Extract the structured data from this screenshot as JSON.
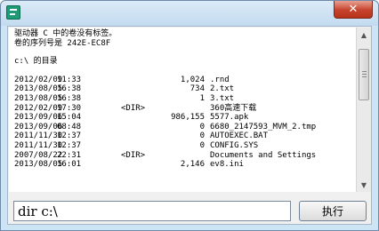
{
  "window": {
    "icon": "app-icon",
    "close_symbol": "✕"
  },
  "output": {
    "header_lines": [
      "驱动器 C 中的卷没有标签。",
      "卷的序列号是 242E-EC8F"
    ],
    "dir_title": "c:\\ 的目录",
    "entries": [
      {
        "date": "2012/02/09",
        "time": "11:33",
        "dir": "",
        "size": "1,024",
        "name": ".rnd"
      },
      {
        "date": "2013/08/05",
        "time": "16:38",
        "dir": "",
        "size": "734",
        "name": "2.txt"
      },
      {
        "date": "2013/08/05",
        "time": "16:38",
        "dir": "",
        "size": "1",
        "name": "3.txt"
      },
      {
        "date": "2012/02/09",
        "time": "17:30",
        "dir": "<DIR>",
        "size": "",
        "name": "360高速下载"
      },
      {
        "date": "2013/09/06",
        "time": "15:04",
        "dir": "",
        "size": "986,155",
        "name": "5577.apk"
      },
      {
        "date": "2013/09/06",
        "time": "08:48",
        "dir": "",
        "size": "0",
        "name": "6680_2147593_MVM_2.tmp"
      },
      {
        "date": "2011/11/30",
        "time": "12:37",
        "dir": "",
        "size": "0",
        "name": "AUTOEXEC.BAT"
      },
      {
        "date": "2011/11/30",
        "time": "12:37",
        "dir": "",
        "size": "0",
        "name": "CONFIG.SYS"
      },
      {
        "date": "2007/08/22",
        "time": "22:31",
        "dir": "<DIR>",
        "size": "",
        "name": "Documents and Settings"
      },
      {
        "date": "2013/08/05",
        "time": "16:01",
        "dir": "",
        "size": "2,146",
        "name": "ev8.ini"
      }
    ]
  },
  "command": {
    "value": "dir c:\\",
    "button_label": "执行"
  },
  "scrollbar": {
    "up_icon": "▲",
    "down_icon": "▼"
  }
}
